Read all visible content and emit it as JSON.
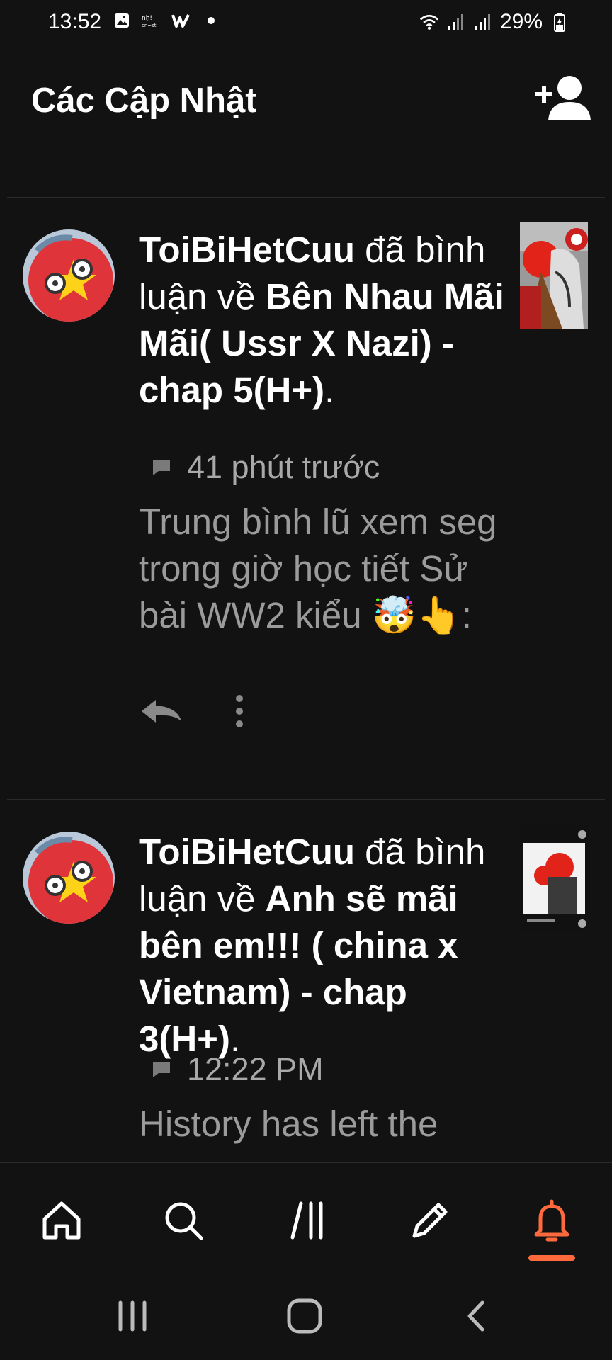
{
  "status_bar": {
    "time": "13:52",
    "battery": "29%",
    "icons": [
      "gallery-icon",
      "app-logo-icon",
      "wattpad-icon",
      "dot-icon",
      "wifi-icon",
      "signal-icon",
      "signal-icon",
      "battery-charging-icon"
    ]
  },
  "header": {
    "title": "Các Cập Nhật",
    "action_icon": "add-user-icon"
  },
  "notifications": [
    {
      "user": "ToiBiHetCuu",
      "action_text": " đã bình luận về ",
      "story": "Bên Nhau Mãi Mãi( Ussr X Nazi) - chap 5(H+)",
      "end": ".",
      "time": "41 phút trước",
      "comment": "Trung bình lũ xem seg trong giờ học tiết Sử bài WW2 kiểu 🤯👆:",
      "icon": "comment-icon"
    },
    {
      "user": "ToiBiHetCuu",
      "action_text": " đã bình luận về ",
      "story": "Anh sẽ mãi bên em!!! ( china x Vietnam) - chap 3(H+)",
      "end": ".",
      "time": "12:22 PM",
      "comment": "History has left the",
      "icon": "comment-icon"
    }
  ],
  "bottom_nav": {
    "items": [
      "home-icon",
      "search-icon",
      "library-icon",
      "write-icon",
      "notifications-bell-icon"
    ],
    "active": "notifications-bell-icon",
    "active_color": "#ff6a3c"
  },
  "system_nav": [
    "recent-apps-icon",
    "home-button-icon",
    "back-icon"
  ]
}
